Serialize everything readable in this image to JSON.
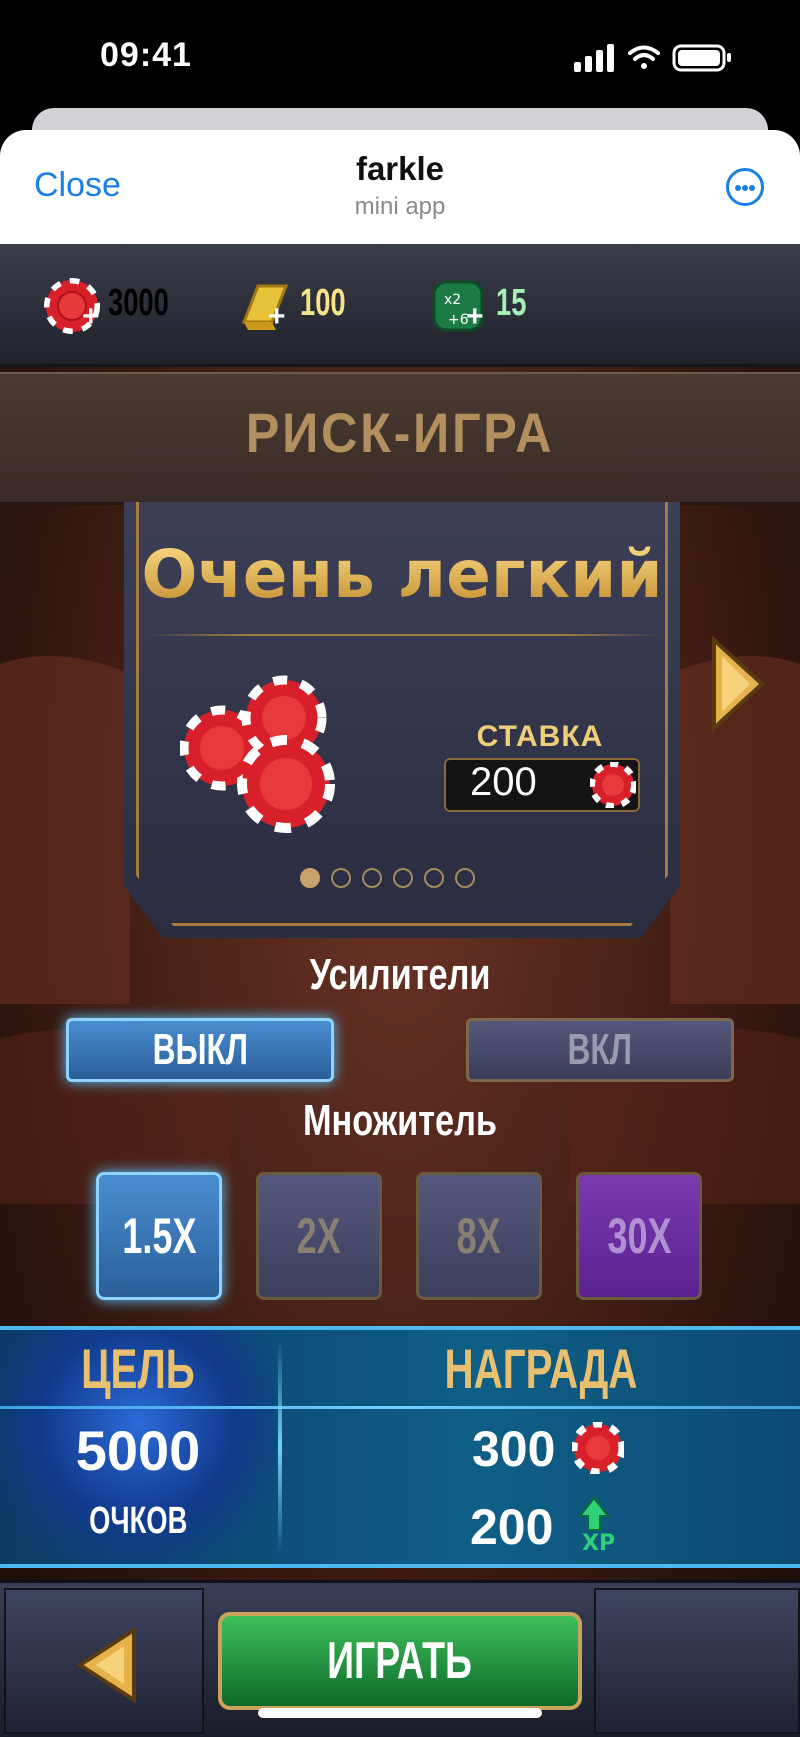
{
  "status_bar": {
    "time": "09:41"
  },
  "miniapp_header": {
    "close_label": "Close",
    "title": "farkle",
    "subtitle": "mini app"
  },
  "currencies": [
    {
      "name": "chips",
      "value": "3000",
      "color": "#ffffff"
    },
    {
      "name": "gold",
      "value": "100",
      "color": "#f7e38a"
    },
    {
      "name": "dice",
      "value": "15",
      "color": "#a6f0b6"
    }
  ],
  "banner": {
    "title": "РИСК-ИГРА"
  },
  "card": {
    "difficulty": "Очень легкий",
    "stake_label": "СТАВКА",
    "stake_value": "200",
    "page_count": 6,
    "active_page": 1
  },
  "boosters": {
    "label": "Усилители",
    "off_label": "ВЫКЛ",
    "on_label": "ВКЛ",
    "selected": "off"
  },
  "multiplier": {
    "label": "Множитель",
    "options": [
      "1.5X",
      "2X",
      "8X",
      "30X"
    ],
    "selected": "1.5X"
  },
  "goal": {
    "heading": "ЦЕЛЬ",
    "value": "5000",
    "unit": "ОЧКОВ",
    "reward_heading": "НАГРАДА",
    "reward_chips": "300",
    "reward_xp": "200"
  },
  "bottom_bar": {
    "play_label": "ИГРАТЬ"
  },
  "colors": {
    "accent_gold": "#e8c070",
    "select_blue": "#4fc3ff",
    "play_green": "#2da84a"
  }
}
